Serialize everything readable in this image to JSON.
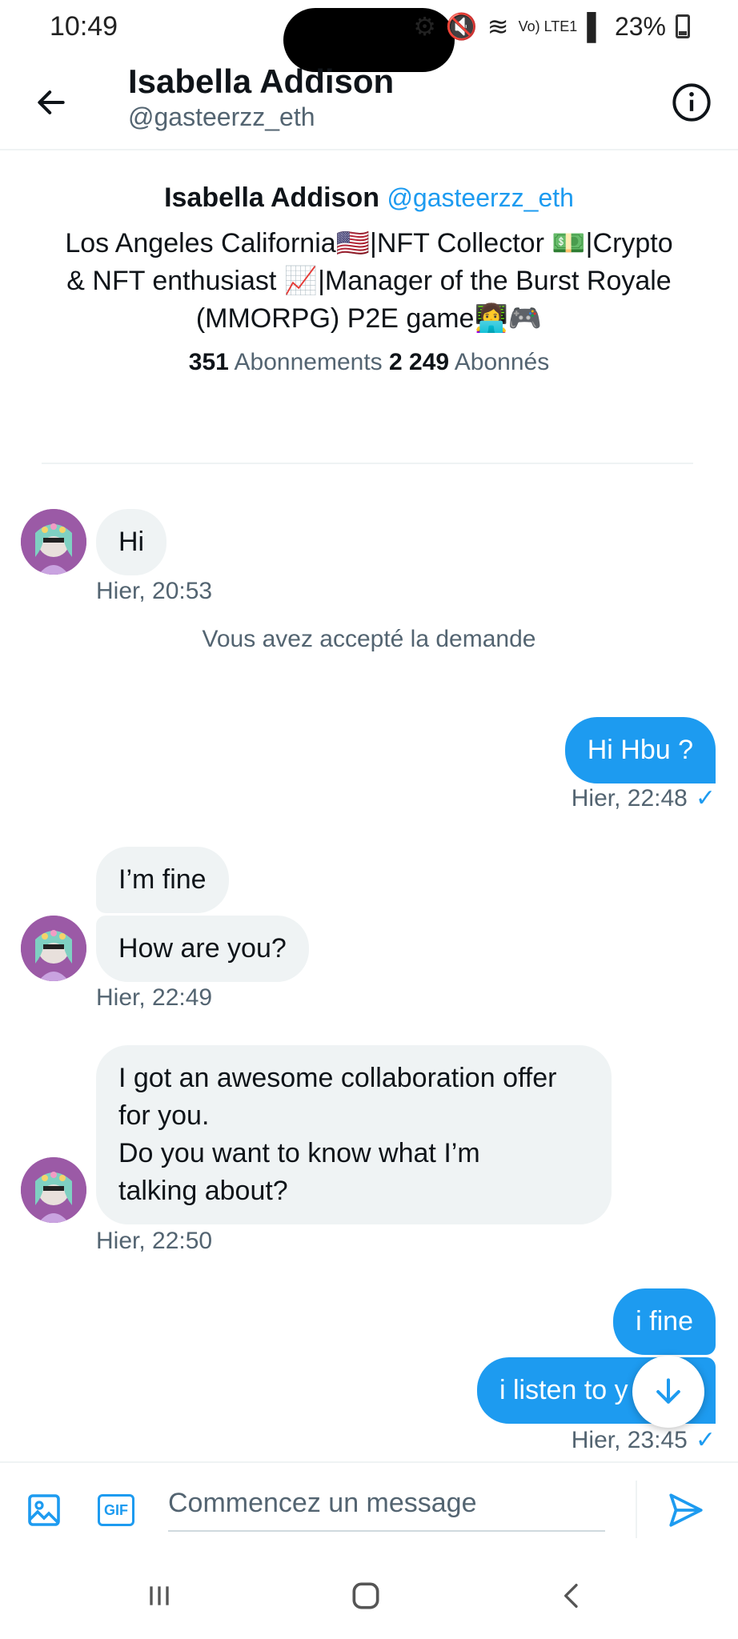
{
  "status_bar": {
    "time": "10:49",
    "signal_label": "Vo) LTE1",
    "battery": "23%"
  },
  "header": {
    "name": "Isabella Addison",
    "handle": "@gasteerzz_eth"
  },
  "profile": {
    "name": "Isabella Addison",
    "handle": "@gasteerzz_eth",
    "bio_line1": "Los Angeles California🇺🇸|NFT Collector 💵|Crypto",
    "bio_line2": "& NFT enthusiast 📈|Manager of the Burst Royale",
    "bio_line3": "(MMORPG) P2E game👩‍💻🎮",
    "following_count": "351",
    "following_label": "Abonnements",
    "followers_count": "2 249",
    "followers_label": "Abonnés"
  },
  "messages": {
    "m1": "Hi",
    "m1_time": "Hier, 20:53",
    "system": "Vous avez accepté la demande",
    "m2": "Hi Hbu ?",
    "m2_time": "Hier, 22:48",
    "m3": "I’m fine",
    "m4": "How are you?",
    "m4_time": "Hier, 22:49",
    "m5_line1": "I got an awesome collaboration offer",
    "m5_line2": "for you.",
    "m5_line3": "Do you want to know what I’m",
    "m5_line4": "talking about?",
    "m5_time": "Hier, 22:50",
    "m6": "i fine",
    "m7": "i listen to y",
    "m7_time": "Hier, 23:45"
  },
  "composer": {
    "placeholder": "Commencez un message",
    "gif_label": "GIF"
  },
  "icons": {
    "back": "arrow-left-icon",
    "info": "info-circle-icon",
    "media": "image-icon",
    "gif": "gif-icon",
    "send": "send-icon",
    "scroll_down": "arrow-down-icon"
  },
  "colors": {
    "accent": "#1d9bf0",
    "incoming_bubble": "#eff3f4",
    "secondary_text": "#536471"
  }
}
